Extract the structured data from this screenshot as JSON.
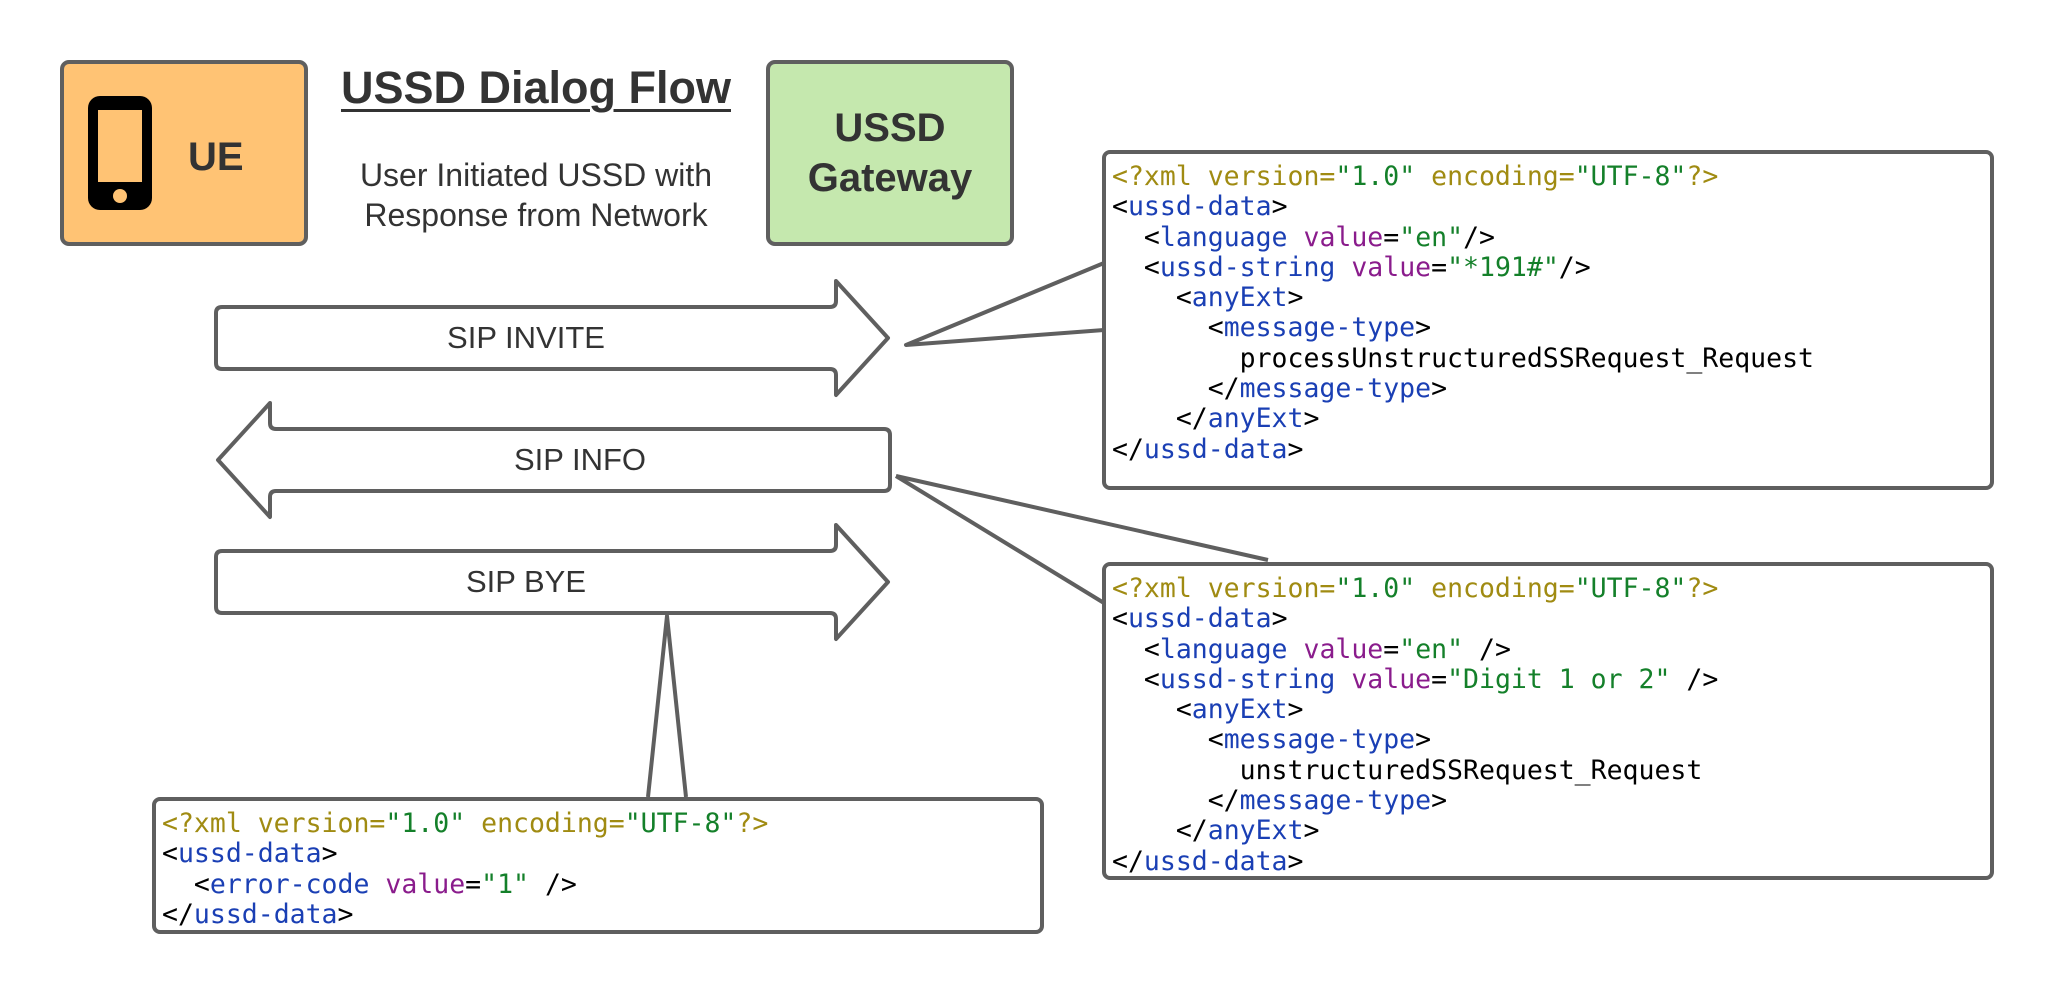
{
  "title": "USSD Dialog Flow",
  "subtitle_lines": [
    "User Initiated USSD with",
    "Response from Network"
  ],
  "nodes": {
    "ue": {
      "label": "UE",
      "icon": "mobile-phone-icon",
      "color": "#ffc374"
    },
    "gateway": {
      "label_lines": [
        "USSD",
        "Gateway"
      ],
      "color": "#c5e8ae"
    }
  },
  "arrows": [
    {
      "label": "SIP INVITE",
      "direction": "right"
    },
    {
      "label": "SIP INFO",
      "direction": "left"
    },
    {
      "label": "SIP BYE",
      "direction": "right"
    }
  ],
  "colors": {
    "stroke": "#5f5f5f",
    "text": "#333333",
    "xml_declaration": "#a08b12",
    "xml_string": "#14802a",
    "xml_tag": "#1a3fb4",
    "xml_attribute": "#8a1c8c"
  },
  "code_blocks": {
    "invite": {
      "attached_to": "SIP INVITE",
      "lines": [
        [
          [
            "decl",
            "<?xml version="
          ],
          [
            "str",
            "\"1.0\""
          ],
          [
            "decl",
            " encoding="
          ],
          [
            "str",
            "\"UTF-8\""
          ],
          [
            "decl",
            "?>"
          ]
        ],
        [
          [
            "text",
            "<"
          ],
          [
            "tag",
            "ussd-data"
          ],
          [
            "text",
            ">"
          ]
        ],
        [
          [
            "text",
            "  <"
          ],
          [
            "tag",
            "language"
          ],
          [
            "text",
            " "
          ],
          [
            "attr",
            "value"
          ],
          [
            "text",
            "="
          ],
          [
            "str",
            "\"en\""
          ],
          [
            "text",
            "/>"
          ]
        ],
        [
          [
            "text",
            "  <"
          ],
          [
            "tag",
            "ussd-string"
          ],
          [
            "text",
            " "
          ],
          [
            "attr",
            "value"
          ],
          [
            "text",
            "="
          ],
          [
            "str",
            "\"*191#\""
          ],
          [
            "text",
            "/>"
          ]
        ],
        [
          [
            "text",
            "    <"
          ],
          [
            "tag",
            "anyExt"
          ],
          [
            "text",
            ">"
          ]
        ],
        [
          [
            "text",
            "      <"
          ],
          [
            "tag",
            "message-type"
          ],
          [
            "text",
            ">"
          ]
        ],
        [
          [
            "text",
            "        processUnstructuredSSRequest_Request"
          ]
        ],
        [
          [
            "text",
            "      </"
          ],
          [
            "tag",
            "message-type"
          ],
          [
            "text",
            ">"
          ]
        ],
        [
          [
            "text",
            "    </"
          ],
          [
            "tag",
            "anyExt"
          ],
          [
            "text",
            ">"
          ]
        ],
        [
          [
            "text",
            "</"
          ],
          [
            "tag",
            "ussd-data"
          ],
          [
            "text",
            ">"
          ]
        ]
      ]
    },
    "info": {
      "attached_to": "SIP INFO",
      "lines": [
        [
          [
            "decl",
            "<?xml version="
          ],
          [
            "str",
            "\"1.0\""
          ],
          [
            "decl",
            " encoding="
          ],
          [
            "str",
            "\"UTF-8\""
          ],
          [
            "decl",
            "?>"
          ]
        ],
        [
          [
            "text",
            "<"
          ],
          [
            "tag",
            "ussd-data"
          ],
          [
            "text",
            ">"
          ]
        ],
        [
          [
            "text",
            "  <"
          ],
          [
            "tag",
            "language"
          ],
          [
            "text",
            " "
          ],
          [
            "attr",
            "value"
          ],
          [
            "text",
            "="
          ],
          [
            "str",
            "\"en\""
          ],
          [
            "text",
            " />"
          ]
        ],
        [
          [
            "text",
            "  <"
          ],
          [
            "tag",
            "ussd-string"
          ],
          [
            "text",
            " "
          ],
          [
            "attr",
            "value"
          ],
          [
            "text",
            "="
          ],
          [
            "str",
            "\"Digit 1 or 2\""
          ],
          [
            "text",
            " />"
          ]
        ],
        [
          [
            "text",
            "    <"
          ],
          [
            "tag",
            "anyExt"
          ],
          [
            "text",
            ">"
          ]
        ],
        [
          [
            "text",
            "      <"
          ],
          [
            "tag",
            "message-type"
          ],
          [
            "text",
            ">"
          ]
        ],
        [
          [
            "text",
            "        unstructuredSSRequest_Request"
          ]
        ],
        [
          [
            "text",
            "      </"
          ],
          [
            "tag",
            "message-type"
          ],
          [
            "text",
            ">"
          ]
        ],
        [
          [
            "text",
            "    </"
          ],
          [
            "tag",
            "anyExt"
          ],
          [
            "text",
            ">"
          ]
        ],
        [
          [
            "text",
            "</"
          ],
          [
            "tag",
            "ussd-data"
          ],
          [
            "text",
            ">"
          ]
        ]
      ]
    },
    "bye": {
      "attached_to": "SIP BYE",
      "lines": [
        [
          [
            "decl",
            "<?xml version="
          ],
          [
            "str",
            "\"1.0\""
          ],
          [
            "decl",
            " encoding="
          ],
          [
            "str",
            "\"UTF-8\""
          ],
          [
            "decl",
            "?>"
          ]
        ],
        [
          [
            "text",
            "<"
          ],
          [
            "tag",
            "ussd-data"
          ],
          [
            "text",
            ">"
          ]
        ],
        [
          [
            "text",
            "  <"
          ],
          [
            "tag",
            "error-code"
          ],
          [
            "text",
            " "
          ],
          [
            "attr",
            "value"
          ],
          [
            "text",
            "="
          ],
          [
            "str",
            "\"1\""
          ],
          [
            "text",
            " />"
          ]
        ],
        [
          [
            "text",
            "</"
          ],
          [
            "tag",
            "ussd-data"
          ],
          [
            "text",
            ">"
          ]
        ]
      ]
    }
  }
}
